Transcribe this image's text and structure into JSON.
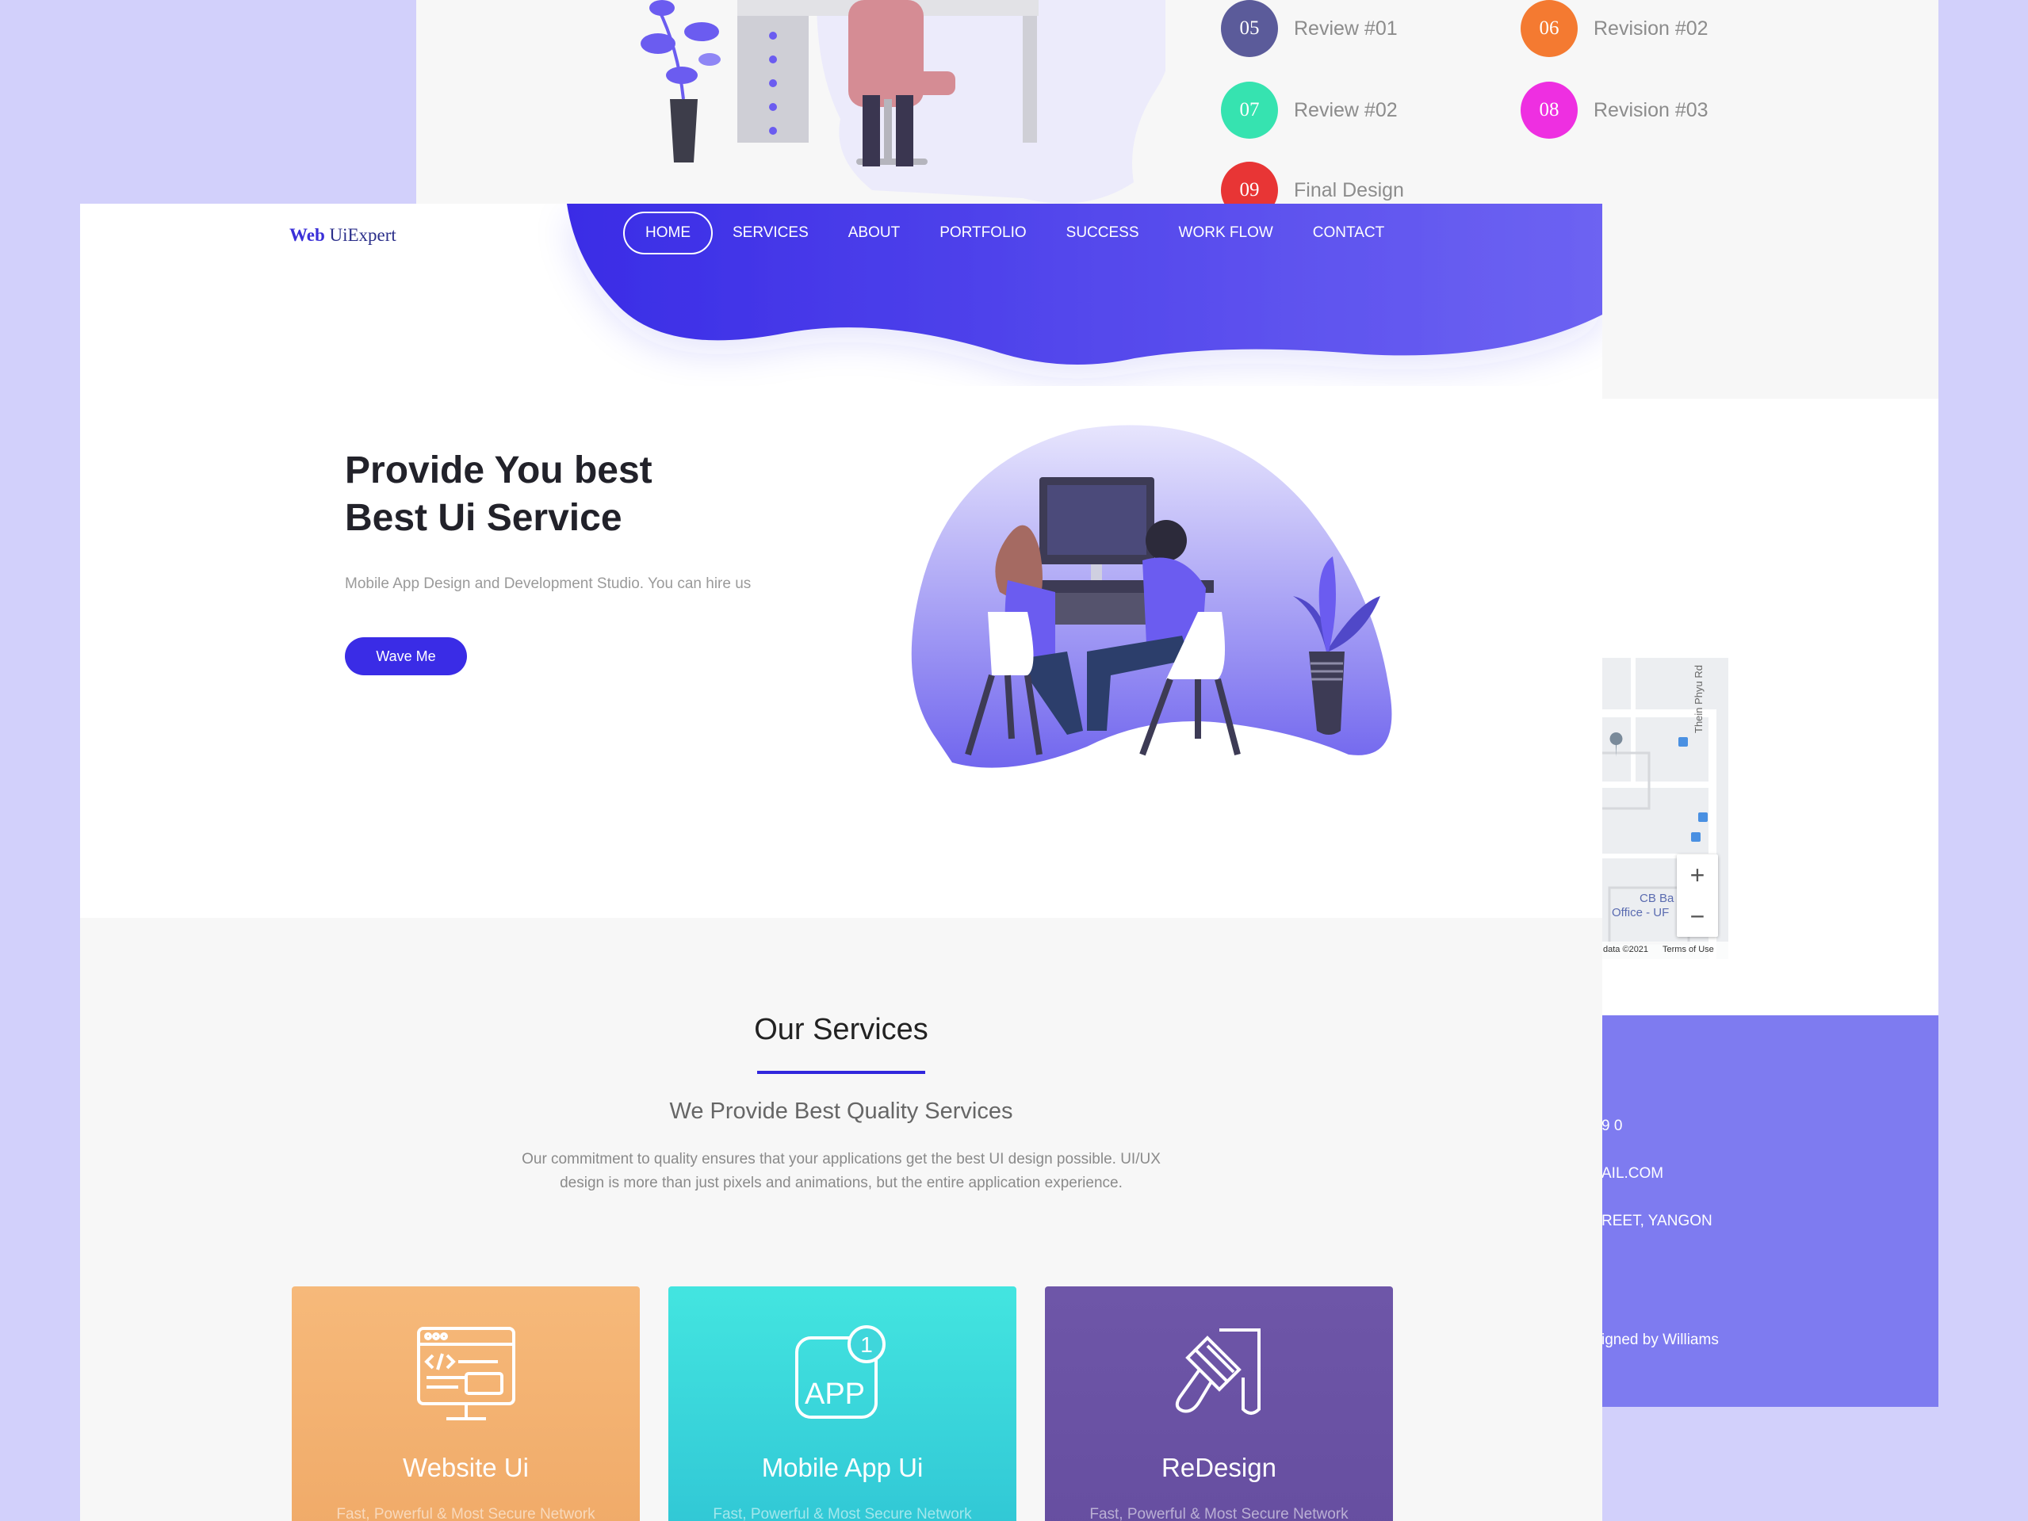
{
  "back_page": {
    "steps": [
      {
        "num": "05",
        "label": "Review #01",
        "color": "#5b5b9a"
      },
      {
        "num": "06",
        "label": "Revision #02",
        "color": "#f47a31"
      },
      {
        "num": "07",
        "label": "Review #02",
        "color": "#36e3b0"
      },
      {
        "num": "08",
        "label": "Revision #03",
        "color": "#ee2fe1"
      },
      {
        "num": "09",
        "label": "Final Design",
        "color": "#e83535"
      }
    ],
    "map": {
      "road_label": "Thein Phyu Rd",
      "place_label_1": "CB Ba",
      "place_label_2": "Office - UF",
      "data_label": "data ©2021",
      "terms": "Terms of Use",
      "zoom_in": "+",
      "zoom_out": "−"
    },
    "footer": {
      "phone_fragment": "9 0",
      "email_fragment": "AIL.COM",
      "address_fragment": "REET, YANGON",
      "credit_fragment": "igned by Williams"
    }
  },
  "front_page": {
    "logo": {
      "bold": "Web",
      "rest": " UiExpert"
    },
    "nav": [
      "HOME",
      "SERVICES",
      "ABOUT",
      "PORTFOLIO",
      "SUCCESS",
      "WORK FLOW",
      "CONTACT"
    ],
    "hero": {
      "title_line1": "Provide You best",
      "title_line2": "Best Ui Service",
      "subtitle": "Mobile App Design and Development Studio. You can hire us",
      "button": "Wave Me"
    },
    "services": {
      "title": "Our Services",
      "subtitle": "We Provide Best Quality Services",
      "description": "Our commitment to quality ensures that your applications get the best UI design possible. UI/UX design is more than just pixels and animations, but the entire application experience.",
      "cards": [
        {
          "title": "Website Ui",
          "desc": "Fast, Powerful & Most Secure Network",
          "color_top": "#f6b97a",
          "color_bottom": "#f0aa68"
        },
        {
          "title": "Mobile App Ui",
          "desc": "Fast, Powerful & Most Secure Network",
          "color_top": "#43e5e0",
          "color_bottom": "#30c6d5",
          "icon_text": "APP",
          "badge": "1"
        },
        {
          "title": "ReDesign",
          "desc": "Fast, Powerful & Most Secure Network",
          "color_top": "#6e56a8",
          "color_bottom": "#664ea0"
        }
      ]
    }
  },
  "colors": {
    "accent": "#3a2ce6",
    "background": "#d2d0fb",
    "footer": "#7e7bf0"
  }
}
